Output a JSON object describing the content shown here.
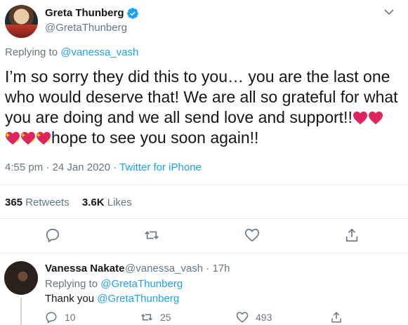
{
  "tweet": {
    "author_name": "Greta Thunberg",
    "author_handle": "@GretaThunberg",
    "replying_prefix": "Replying to ",
    "replying_to": "@vanessa_vash",
    "text_part1": "I’m so sorry they did this to you… you are the last one who would deserve that! We are all so grateful for what you are doing and we all send love and support!!",
    "text_part2": "hope to see you soon again!!",
    "timestamp": "4:55 pm · 24 Jan 2020 · ",
    "source": "Twitter for iPhone",
    "retweets_count": "365",
    "retweets_label": " Retweets",
    "likes_count": "3.6K",
    "likes_label": " Likes",
    "icons": [
      "verified-badge",
      "chevron-down",
      "red-heart",
      "sparkling-heart",
      "reply",
      "retweet",
      "like",
      "share"
    ]
  },
  "reply": {
    "author_name": "Vanessa Nakate",
    "author_handle": "@vanessa_vash · 17h",
    "replying_prefix": "Replying to ",
    "replying_to": "@GretaThunberg",
    "text_prefix": "Thank you ",
    "text_mention": "@GretaThunberg",
    "reply_count": "10",
    "retweet_count": "25",
    "like_count": "493"
  },
  "colors": {
    "accent": "#1da1f2",
    "secondary_text": "#657786",
    "heart_red": "#e0245e",
    "divider": "#e6ecf0"
  }
}
